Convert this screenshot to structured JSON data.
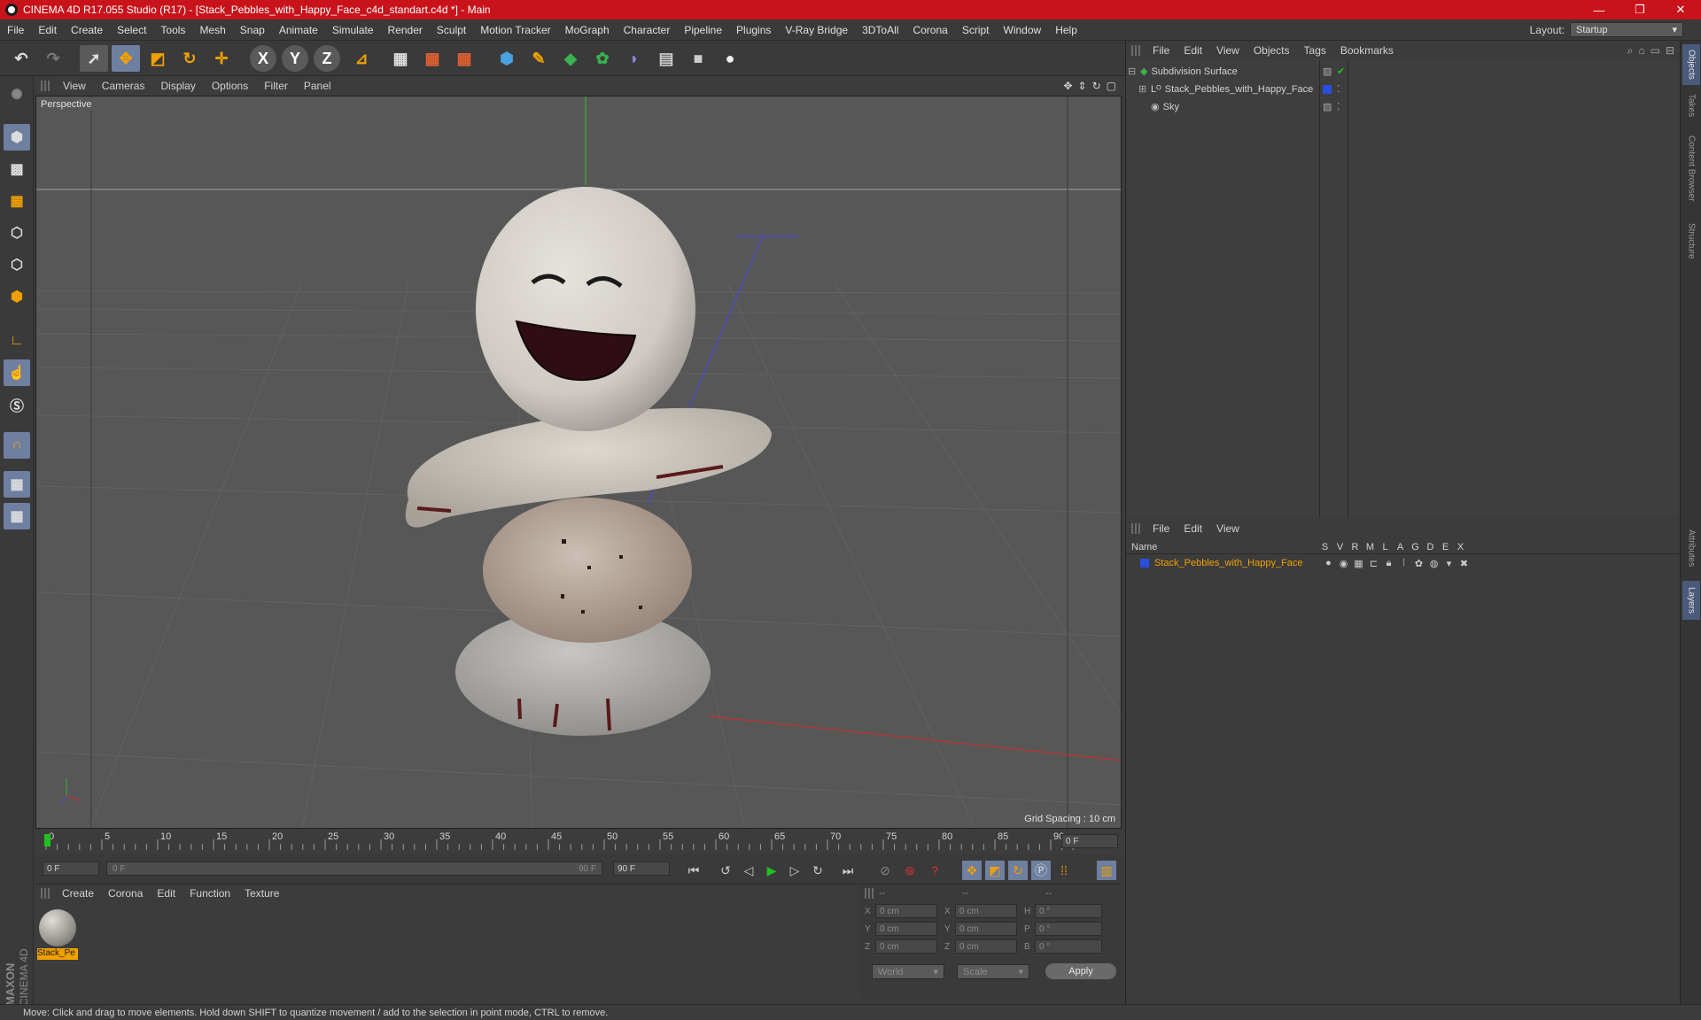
{
  "window": {
    "title": "CINEMA 4D R17.055 Studio (R17) - [Stack_Pebbles_with_Happy_Face_c4d_standart.c4d *] - Main",
    "minimize": "—",
    "maximize": "❐",
    "close": "✕"
  },
  "menu": [
    "File",
    "Edit",
    "Create",
    "Select",
    "Tools",
    "Mesh",
    "Snap",
    "Animate",
    "Simulate",
    "Render",
    "Sculpt",
    "Motion Tracker",
    "MoGraph",
    "Character",
    "Pipeline",
    "Plugins",
    "V-Ray Bridge",
    "3DToAll",
    "Corona",
    "Script",
    "Window",
    "Help"
  ],
  "layout": {
    "label": "Layout:",
    "value": "Startup"
  },
  "viewport": {
    "menu": [
      "View",
      "Cameras",
      "Display",
      "Options",
      "Filter",
      "Panel"
    ],
    "label": "Perspective",
    "grid_spacing": "Grid Spacing : 10 cm"
  },
  "timeline": {
    "ticks": [
      "0",
      "5",
      "10",
      "15",
      "20",
      "25",
      "30",
      "35",
      "40",
      "45",
      "50",
      "55",
      "60",
      "65",
      "70",
      "75",
      "80",
      "85",
      "90"
    ],
    "current_frame": "0 F"
  },
  "playbar": {
    "start": "0 F",
    "range_start": "0 F",
    "range_end": "90 F",
    "end": "90 F"
  },
  "material_manager": {
    "menu": [
      "Create",
      "Corona",
      "Edit",
      "Function",
      "Texture"
    ],
    "materials": [
      {
        "name": "Stack_Pe"
      }
    ]
  },
  "coordinates": {
    "header": [
      "--",
      "--",
      "--"
    ],
    "rows": [
      {
        "a": "X",
        "av": "0 cm",
        "b": "X",
        "bv": "0 cm",
        "c": "H",
        "cv": "0 °"
      },
      {
        "a": "Y",
        "av": "0 cm",
        "b": "Y",
        "bv": "0 cm",
        "c": "P",
        "cv": "0 °"
      },
      {
        "a": "Z",
        "av": "0 cm",
        "b": "Z",
        "bv": "0 cm",
        "c": "B",
        "cv": "0 °"
      }
    ],
    "world": "World",
    "scale": "Scale",
    "apply": "Apply"
  },
  "object_manager": {
    "menu": [
      "File",
      "Edit",
      "View",
      "Objects",
      "Tags",
      "Bookmarks"
    ],
    "objects": [
      {
        "name": "Subdivision Surface"
      },
      {
        "name": "Stack_Pebbles_with_Happy_Face"
      },
      {
        "name": "Sky"
      }
    ]
  },
  "layer_manager": {
    "menu": [
      "File",
      "Edit",
      "View"
    ],
    "name_header": "Name",
    "columns": [
      "S",
      "V",
      "R",
      "M",
      "L",
      "A",
      "G",
      "D",
      "E",
      "X"
    ],
    "layers": [
      {
        "name": "Stack_Pebbles_with_Happy_Face",
        "color": "#2a4fe0"
      }
    ]
  },
  "right_tabs": [
    "Objects",
    "Takes",
    "Content Browser",
    "Structure",
    "Attributes",
    "Layers"
  ],
  "status": "Move: Click and drag to move elements. Hold down SHIFT to quantize movement / add to the selection in point mode, CTRL to remove.",
  "brand": "MAXON CINEMA 4D",
  "colors": {
    "titlebar": "#c8131b",
    "accent_orange": "#f0a000",
    "selection_blue": "#2a4fe0"
  }
}
